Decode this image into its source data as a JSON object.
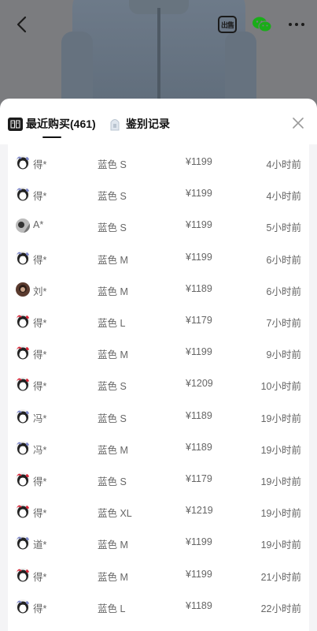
{
  "tabs": {
    "recent_label": "最近购买(461)",
    "auth_label": "鉴别记录"
  },
  "icons": {
    "back": "chevron-left-icon",
    "chu": "chu-share-icon",
    "chu_text": "出售",
    "wechat": "wechat-icon",
    "more": "more-horizontal-icon",
    "close": "close-icon"
  },
  "colors": {
    "sheet": "#ffffff",
    "text_primary": "#111111",
    "text_secondary": "#666666",
    "backdrop": "#7b7c7f"
  },
  "purchases": [
    {
      "buyer": "得*",
      "variant": "蓝色 S",
      "price": "¥1199",
      "time": "4小时前",
      "avatar": "penguin"
    },
    {
      "buyer": "得*",
      "variant": "蓝色 S",
      "price": "¥1199",
      "time": "4小时前",
      "avatar": "penguin"
    },
    {
      "buyer": "A*",
      "variant": "蓝色 S",
      "price": "¥1199",
      "time": "5小时前",
      "avatar": "photo-bw"
    },
    {
      "buyer": "得*",
      "variant": "蓝色 M",
      "price": "¥1199",
      "time": "6小时前",
      "avatar": "penguin"
    },
    {
      "buyer": "刘*",
      "variant": "蓝色 M",
      "price": "¥1189",
      "time": "6小时前",
      "avatar": "photo-dark"
    },
    {
      "buyer": "得*",
      "variant": "蓝色 L",
      "price": "¥1179",
      "time": "7小时前",
      "avatar": "penguin-red"
    },
    {
      "buyer": "得*",
      "variant": "蓝色 M",
      "price": "¥1199",
      "time": "9小时前",
      "avatar": "penguin-red"
    },
    {
      "buyer": "得*",
      "variant": "蓝色 S",
      "price": "¥1209",
      "time": "10小时前",
      "avatar": "penguin-red"
    },
    {
      "buyer": "冯*",
      "variant": "蓝色 S",
      "price": "¥1189",
      "time": "19小时前",
      "avatar": "penguin"
    },
    {
      "buyer": "冯*",
      "variant": "蓝色 M",
      "price": "¥1189",
      "time": "19小时前",
      "avatar": "penguin"
    },
    {
      "buyer": "得*",
      "variant": "蓝色 S",
      "price": "¥1179",
      "time": "19小时前",
      "avatar": "penguin-red"
    },
    {
      "buyer": "得*",
      "variant": "蓝色 XL",
      "price": "¥1219",
      "time": "19小时前",
      "avatar": "penguin-red"
    },
    {
      "buyer": "道*",
      "variant": "蓝色 M",
      "price": "¥1199",
      "time": "19小时前",
      "avatar": "penguin"
    },
    {
      "buyer": "得*",
      "variant": "蓝色 M",
      "price": "¥1199",
      "time": "21小时前",
      "avatar": "penguin-red"
    },
    {
      "buyer": "得*",
      "variant": "蓝色 L",
      "price": "¥1189",
      "time": "22小时前",
      "avatar": "penguin"
    }
  ]
}
